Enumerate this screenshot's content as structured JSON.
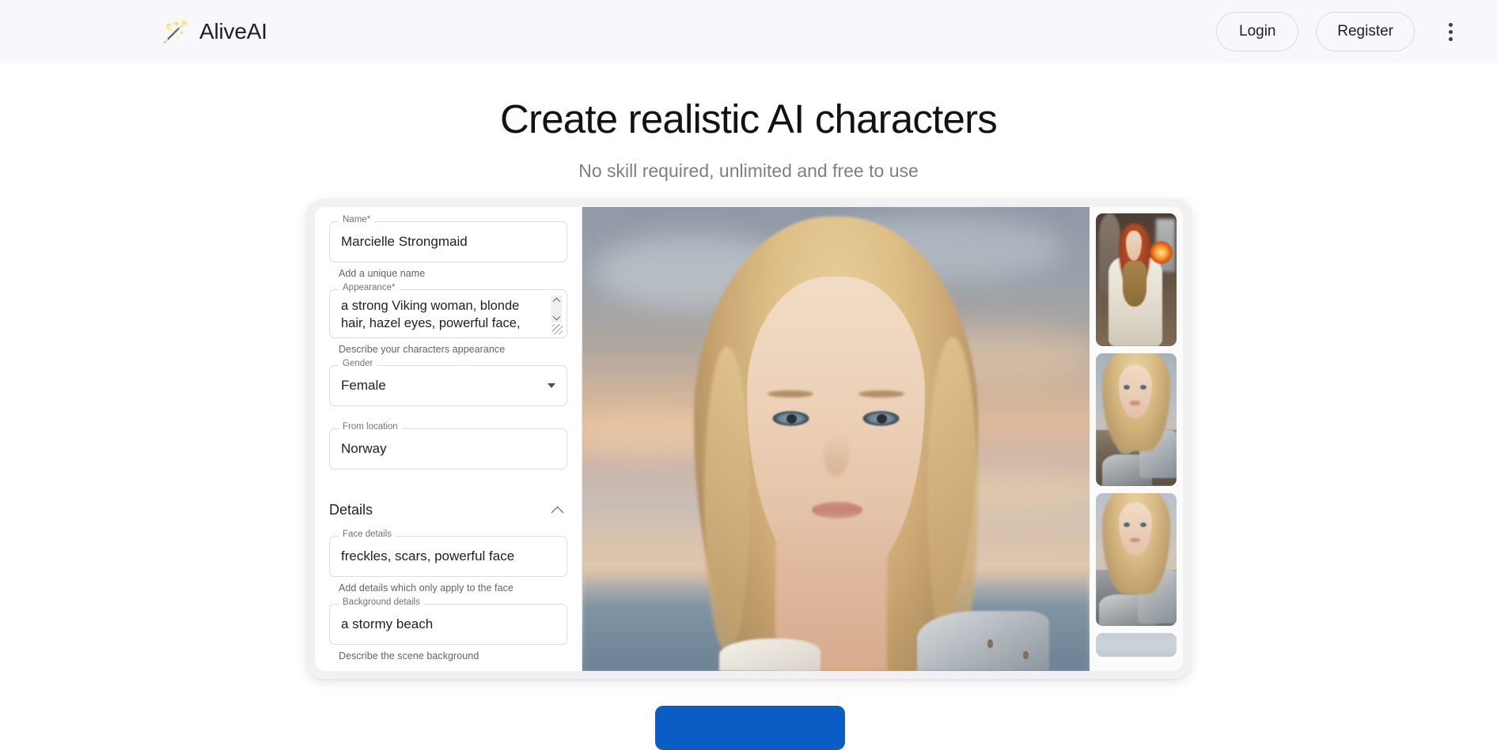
{
  "header": {
    "brand_icon": "magic-wand-icon",
    "brand_icon_glyph": "🪄",
    "brand_name": "AliveAI",
    "login_label": "Login",
    "register_label": "Register",
    "menu_icon": "kebab-menu-icon"
  },
  "hero": {
    "title": "Create realistic AI characters",
    "subtitle": "No skill required, unlimited and free to use"
  },
  "form": {
    "name": {
      "label": "Name*",
      "value": "Marcielle Strongmaid",
      "helper": "Add a unique name"
    },
    "appearance": {
      "label": "Appearance*",
      "value": "a strong Viking woman, blonde hair, hazel eyes, powerful face,",
      "helper": "Describe your characters appearance"
    },
    "gender": {
      "label": "Gender",
      "value": "Female"
    },
    "location": {
      "label": "From location",
      "value": "Norway"
    },
    "details_section": {
      "title": "Details",
      "toggle_icon": "chevron-up-icon"
    },
    "face_details": {
      "label": "Face details",
      "value": "freckles, scars, powerful face",
      "helper": "Add details which only apply to the face"
    },
    "background_details": {
      "label": "Background details",
      "value": "a stormy beach",
      "helper": "Describe the scene background"
    }
  },
  "preview": {
    "alt": "Generated portrait of a blonde Viking woman with freckles on a stormy beach at sunset"
  },
  "thumbnails": [
    {
      "alt": "Red-haired sorceress holding a glowing orb in a stone hall"
    },
    {
      "alt": "Blonde Viking warrior in metal and fur armor"
    },
    {
      "alt": "Blonde Viking warrior in ornate plate armor at sunset"
    },
    {
      "alt": "Partially visible thumbnail with pale sky"
    }
  ],
  "cta": {
    "label": ""
  },
  "colors": {
    "header_bg": "#F8F8FC",
    "cta_blue": "#0B5CC4",
    "card_frame": "#F1F1F3",
    "text_primary": "#1F1F1F",
    "text_muted": "#7C7F86"
  }
}
